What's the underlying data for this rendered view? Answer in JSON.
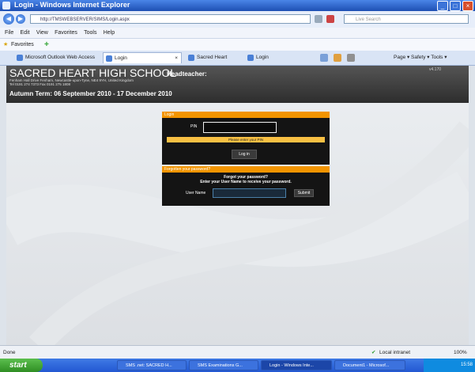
{
  "window": {
    "title": "Login - Windows Internet Explorer",
    "buttons": {
      "min": "_",
      "max": "□",
      "close": "×"
    }
  },
  "address": {
    "url": "http://TMSWEBSERVER/SIMS/Login.aspx",
    "search_placeholder": "Live Search",
    "back": "◀",
    "forward": "▶"
  },
  "menu": {
    "items": [
      "File",
      "Edit",
      "View",
      "Favorites",
      "Tools",
      "Help"
    ]
  },
  "favorites": {
    "label": "Favorites"
  },
  "tabs": {
    "items": [
      {
        "label": "Microsoft Outlook Web Access"
      },
      {
        "label": "Login"
      },
      {
        "label": "Sacred Heart"
      },
      {
        "label": "Login"
      }
    ],
    "commands": "Page ▾   Safety ▾   Tools ▾"
  },
  "site": {
    "school_name": "SACRED HEART HIGH SCHOOL",
    "headteacher_label": "Headteacher:",
    "version": "v4.170",
    "address_line1": "Fenham Hall Drive Fenham, Newcastle-upon-Tyne, NE4 9YH, United Kingdom",
    "address_line2": "Tel 0191 274 7373   Fax 0191 275 1808",
    "term": "Autumn Term: 06 September 2010 - 17 December 2010"
  },
  "login": {
    "header": "Login",
    "pin_label": "PIN",
    "pin_value": "",
    "message": "Please enter your PIN",
    "button": "Log in"
  },
  "forgot": {
    "header": "Forgotten your password?",
    "line1": "Forgot your password?",
    "line2": "Enter your User Name to receive your password.",
    "username_label": "User Name",
    "username_value": "",
    "submit": "Submit"
  },
  "status": {
    "text": "Done",
    "zone": "Local intranet",
    "zoom": "100%"
  },
  "taskbar": {
    "start": "start",
    "tasks": [
      {
        "label": "SMS .net: SACRED H..."
      },
      {
        "label": "SMS Examinations G..."
      },
      {
        "label": "Login - Windows Inte..."
      },
      {
        "label": "Document1 - Microsof..."
      }
    ],
    "clock": "15:58"
  }
}
